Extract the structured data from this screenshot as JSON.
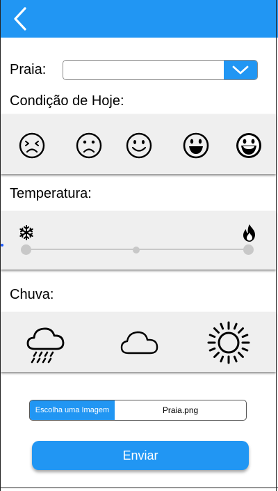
{
  "header": {
    "back_icon": "chevron-left-icon",
    "color": "#2196f3"
  },
  "beach": {
    "label": "Praia:",
    "value": "",
    "dropdown_icon": "chevron-down-icon"
  },
  "condition": {
    "label": "Condição de Hoje:",
    "faces": [
      "stressed-face-icon",
      "sad-face-icon",
      "smile-face-icon",
      "happy-face-icon",
      "very-happy-face-icon"
    ]
  },
  "temperature": {
    "label": "Temperatura:",
    "min_icon": "snowflake-icon",
    "max_icon": "flame-icon",
    "steps": 3
  },
  "rain": {
    "label": "Chuva:",
    "options": [
      "rain-cloud-icon",
      "cloud-icon",
      "sun-icon"
    ]
  },
  "image_upload": {
    "button_label": "Escolha uma Imagem",
    "file_name": "Praia.png"
  },
  "submit": {
    "label": "Enviar"
  }
}
